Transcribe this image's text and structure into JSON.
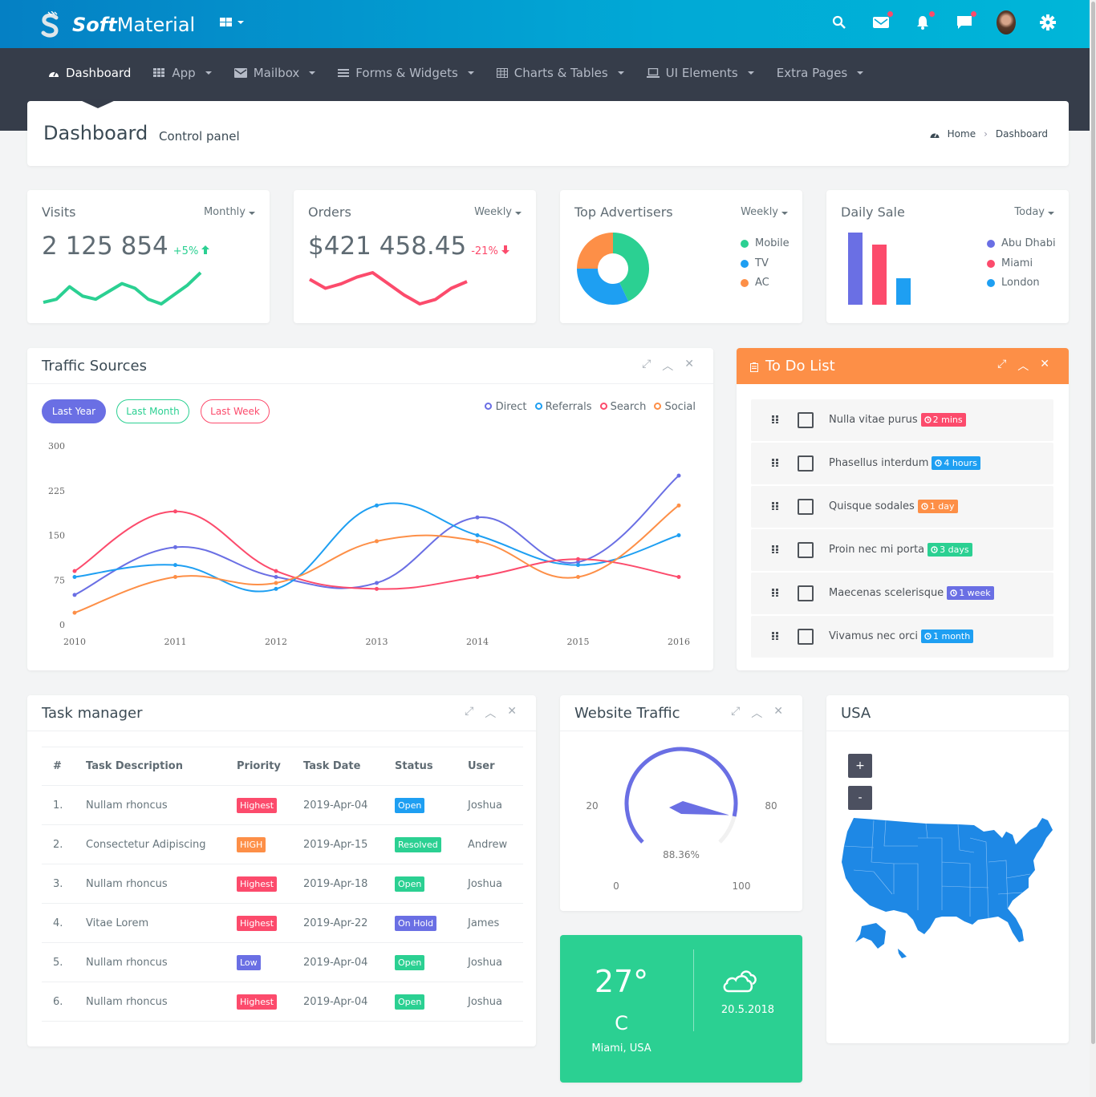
{
  "brand": {
    "bold": "Soft",
    "light": "Material"
  },
  "topbar": {
    "icons": [
      "search-icon",
      "mail-icon",
      "bell-icon",
      "chat-icon",
      "avatar",
      "gear-icon"
    ],
    "badge_color": "#fc4b6c"
  },
  "nav": {
    "items": [
      {
        "label": "Dashboard",
        "icon": "dashboard-icon",
        "active": true,
        "dropdown": false
      },
      {
        "label": "App",
        "icon": "apps-icon",
        "dropdown": true
      },
      {
        "label": "Mailbox",
        "icon": "envelope-icon",
        "dropdown": true
      },
      {
        "label": "Forms & Widgets",
        "icon": "list-icon",
        "dropdown": true
      },
      {
        "label": "Charts & Tables",
        "icon": "table-icon",
        "dropdown": true
      },
      {
        "label": "UI Elements",
        "icon": "laptop-icon",
        "dropdown": true
      },
      {
        "label": "Extra Pages",
        "icon": "",
        "dropdown": true
      }
    ]
  },
  "page_header": {
    "title": "Dashboard",
    "subtitle": "Control panel",
    "breadcrumb": [
      "Home",
      "Dashboard"
    ]
  },
  "stats": {
    "visits": {
      "title": "Visits",
      "period": "Monthly",
      "value": "2 125 854",
      "delta": "+5%",
      "trend": [
        4,
        6,
        14,
        8,
        6,
        11,
        16,
        13,
        6,
        3,
        9,
        15,
        23
      ]
    },
    "orders": {
      "title": "Orders",
      "period": "Weekly",
      "value": "$421 458.45",
      "delta": "-21%",
      "trend": [
        14,
        10,
        12,
        15,
        17,
        12,
        7,
        3,
        5,
        10,
        13
      ]
    },
    "advertisers": {
      "title": "Top Advertisers",
      "period": "Weekly",
      "legend": [
        {
          "label": "Mobile",
          "value": 43,
          "color": "#2bd092"
        },
        {
          "label": "TV",
          "value": 32,
          "color": "#1e9ff2"
        },
        {
          "label": "AC",
          "value": 25,
          "color": "#fd8f47"
        }
      ]
    },
    "daily_sale": {
      "title": "Daily Sale",
      "period": "Today",
      "legend": [
        {
          "label": "Abu Dhabi",
          "value": 9,
          "color": "#6a6fe4"
        },
        {
          "label": "Miami",
          "value": 7.5,
          "color": "#fc4b6c"
        },
        {
          "label": "London",
          "value": 3.3,
          "color": "#1e9ff2"
        }
      ]
    }
  },
  "traffic": {
    "title": "Traffic Sources",
    "filters": [
      "Last Year",
      "Last Month",
      "Last Week"
    ]
  },
  "chart_data": {
    "type": "line",
    "title": "Traffic Sources",
    "x": [
      "2010",
      "2011",
      "2012",
      "2013",
      "2014",
      "2015",
      "2016"
    ],
    "yticks": [
      "0",
      "75",
      "150",
      "225",
      "300"
    ],
    "ylim": [
      0,
      300
    ],
    "grid": false,
    "legend_position": "top-right",
    "series": [
      {
        "name": "Direct",
        "color": "#6a6fe4",
        "values": [
          50,
          130,
          80,
          70,
          180,
          105,
          250
        ]
      },
      {
        "name": "Referrals",
        "color": "#1e9ff2",
        "values": [
          80,
          100,
          60,
          200,
          150,
          100,
          150
        ]
      },
      {
        "name": "Search",
        "color": "#fc4b6c",
        "values": [
          90,
          190,
          90,
          60,
          80,
          110,
          80
        ]
      },
      {
        "name": "Social",
        "color": "#fd8f47",
        "values": [
          20,
          80,
          70,
          140,
          140,
          80,
          200
        ]
      }
    ]
  },
  "todo": {
    "title": "To Do List",
    "items": [
      {
        "text": "Nulla vitae purus",
        "badge": "2 mins",
        "color": "#fc4b6c"
      },
      {
        "text": "Phasellus interdum",
        "badge": "4 hours",
        "color": "#1e9ff2"
      },
      {
        "text": "Quisque sodales",
        "badge": "1 day",
        "color": "#fd8f47"
      },
      {
        "text": "Proin nec mi porta",
        "badge": "3 days",
        "color": "#2bd092"
      },
      {
        "text": "Maecenas scelerisque",
        "badge": "1 week",
        "color": "#6a6fe4"
      },
      {
        "text": "Vivamus nec orci",
        "badge": "1 month",
        "color": "#1e9ff2"
      }
    ]
  },
  "tasks": {
    "title": "Task manager",
    "columns": [
      "#",
      "Task Description",
      "Priority",
      "Task Date",
      "Status",
      "User"
    ],
    "rows": [
      {
        "n": "1.",
        "desc": "Nullam rhoncus",
        "priority": "Highest",
        "pcolor": "#fc4b6c",
        "date": "2019-Apr-04",
        "status": "Open",
        "scolor": "#1e9ff2",
        "user": "Joshua"
      },
      {
        "n": "2.",
        "desc": "Consectetur Adipiscing",
        "priority": "HIGH",
        "pcolor": "#fd8f47",
        "date": "2019-Apr-15",
        "status": "Resolved",
        "scolor": "#2bd092",
        "user": "Andrew"
      },
      {
        "n": "3.",
        "desc": "Nullam rhoncus",
        "priority": "Highest",
        "pcolor": "#fc4b6c",
        "date": "2019-Apr-18",
        "status": "Open",
        "scolor": "#2bd092",
        "user": "Joshua"
      },
      {
        "n": "4.",
        "desc": "Vitae Lorem",
        "priority": "Highest",
        "pcolor": "#fc4b6c",
        "date": "2019-Apr-22",
        "status": "On Hold",
        "scolor": "#6a6fe4",
        "user": "James"
      },
      {
        "n": "5.",
        "desc": "Nullam rhoncus",
        "priority": "Low",
        "pcolor": "#6a6fe4",
        "date": "2019-Apr-04",
        "status": "Open",
        "scolor": "#2bd092",
        "user": "Joshua"
      },
      {
        "n": "6.",
        "desc": "Nullam rhoncus",
        "priority": "Highest",
        "pcolor": "#fc4b6c",
        "date": "2019-Apr-04",
        "status": "Open",
        "scolor": "#2bd092",
        "user": "Joshua"
      }
    ]
  },
  "website_traffic": {
    "title": "Website Traffic",
    "value_label": "88.36%",
    "value": 88.36,
    "ticks": [
      "0",
      "20",
      "80",
      "100"
    ]
  },
  "weather": {
    "temp": "27°",
    "unit": "C",
    "city": "Miami, USA",
    "date": "20.5.2018"
  },
  "map": {
    "title": "USA",
    "zoom_in": "+",
    "zoom_out": "-"
  },
  "colors": {
    "primary": "#6a6fe4",
    "info": "#1e9ff2",
    "danger": "#fc4b6c",
    "warning": "#fd8f47",
    "success": "#2bd092"
  }
}
